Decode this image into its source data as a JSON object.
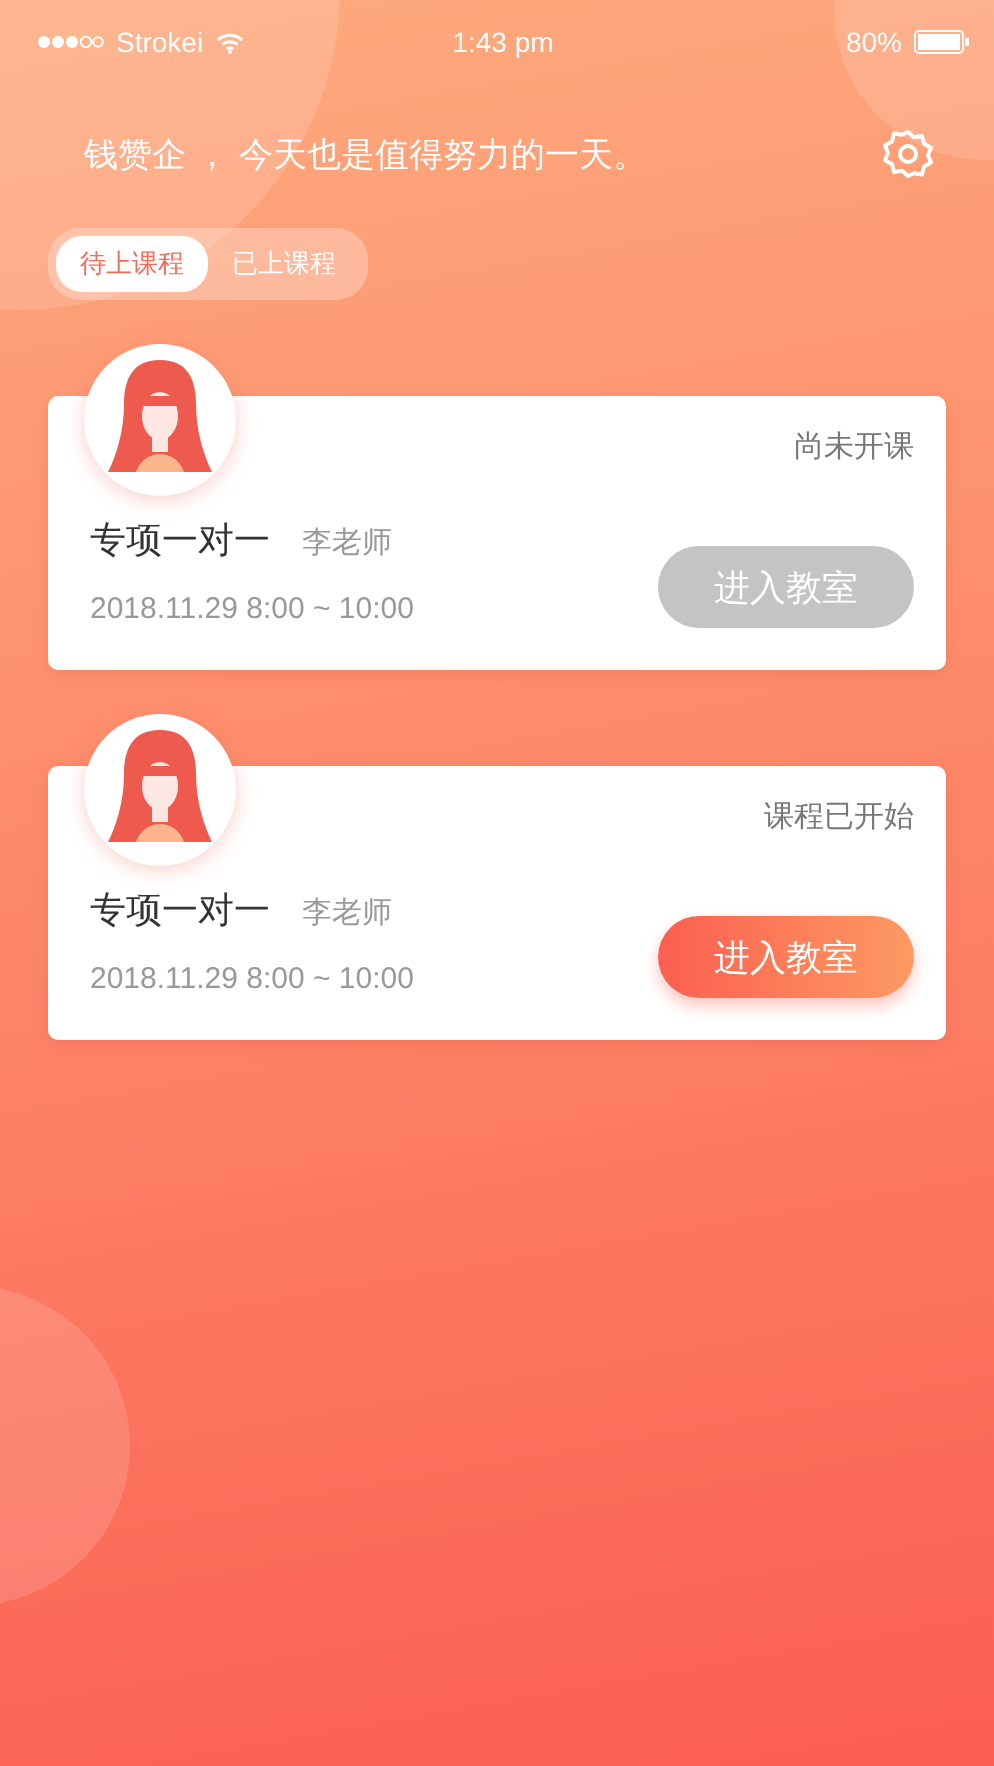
{
  "status_bar": {
    "carrier": "Strokei",
    "time": "1:43 pm",
    "battery": "80%"
  },
  "greeting": "钱赞企 ， 今天也是值得努力的一天。",
  "tabs": [
    {
      "label": "待上课程",
      "selected": true
    },
    {
      "label": "已上课程",
      "selected": false
    }
  ],
  "courses": [
    {
      "status": "尚未开课",
      "title": "专项一对一",
      "teacher": "李老师",
      "time": "2018.11.29 8:00 ~ 10:00",
      "button": {
        "label": "进入教室",
        "disabled": true
      }
    },
    {
      "status": "课程已开始",
      "title": "专项一对一",
      "teacher": "李老师",
      "time": "2018.11.29 8:00 ~ 10:00",
      "button": {
        "label": "进入教室",
        "disabled": false
      }
    }
  ]
}
